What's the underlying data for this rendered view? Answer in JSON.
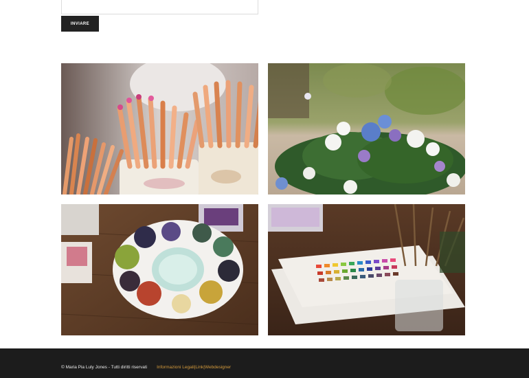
{
  "form": {
    "submit_label": "INVIARE"
  },
  "gallery": {
    "images": [
      {
        "subject": "colored pencils in ceramic cups"
      },
      {
        "subject": "flower bouquet in a garden"
      },
      {
        "subject": "watercolor paint palette on wooden table"
      },
      {
        "subject": "watercolor color charts and brushes"
      }
    ]
  },
  "footer": {
    "copyright": "© Maria Pia Luly Jones - Tutti diritti riservati",
    "links": [
      {
        "label": "Informazioni Legali"
      },
      {
        "label": "Link"
      },
      {
        "label": "Webdesigner"
      }
    ],
    "separator": "|",
    "colors": {
      "background": "#1c1c1c",
      "link": "#d49a3c",
      "text": "#e8e8e8"
    }
  }
}
